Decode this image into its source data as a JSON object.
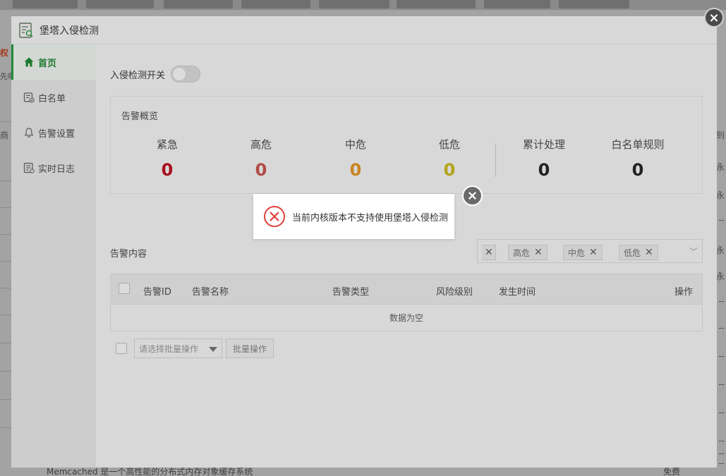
{
  "dialog": {
    "title": "堡塔入侵检测",
    "close_symbol": "×"
  },
  "sidebar": {
    "items": [
      {
        "label": "首页",
        "icon": "home-icon",
        "active": true
      },
      {
        "label": "白名单",
        "icon": "whitelist-icon",
        "active": false
      },
      {
        "label": "告警设置",
        "icon": "bell-icon",
        "active": false
      },
      {
        "label": "实时日志",
        "icon": "log-icon",
        "active": false
      }
    ]
  },
  "switch": {
    "label": "入侵检测开关",
    "on": false
  },
  "overview": {
    "title": "告警概览",
    "stats": [
      {
        "label": "紧急",
        "value": "0",
        "color": "#a8101a"
      },
      {
        "label": "高危",
        "value": "0",
        "color": "#b14a46"
      },
      {
        "label": "中危",
        "value": "0",
        "color": "#c98420"
      },
      {
        "label": "低危",
        "value": "0",
        "color": "#b4a31c"
      },
      {
        "label": "累计处理",
        "value": "0",
        "color": "#222222"
      },
      {
        "label": "白名单规则",
        "value": "0",
        "color": "#222222"
      }
    ]
  },
  "alerts": {
    "label": "告警内容",
    "filter_chips": [
      "高危",
      "中危",
      "低危"
    ],
    "columns": [
      "告警ID",
      "告警名称",
      "告警类型",
      "风险级别",
      "发生时间",
      "操作"
    ],
    "empty_text": "数据为空",
    "batch_placeholder": "请选择批量操作",
    "batch_button": "批量操作"
  },
  "message": {
    "text": "当前内核版本不支持使用堡塔入侵检测"
  },
  "background": {
    "left_texts": [
      "权",
      "先啊",
      "商"
    ],
    "right_texts": [
      "到",
      "永",
      "永",
      "--",
      "永",
      "永",
      "--",
      "--",
      "--",
      "--",
      "--",
      "--",
      "--",
      "--"
    ],
    "footer_text": "Memcached 是一个高性能的分布式内存对象缓存系统",
    "footer_price": "免费"
  },
  "colors": {
    "accent_green": "#1f8a35",
    "error_red": "#e0403a"
  }
}
